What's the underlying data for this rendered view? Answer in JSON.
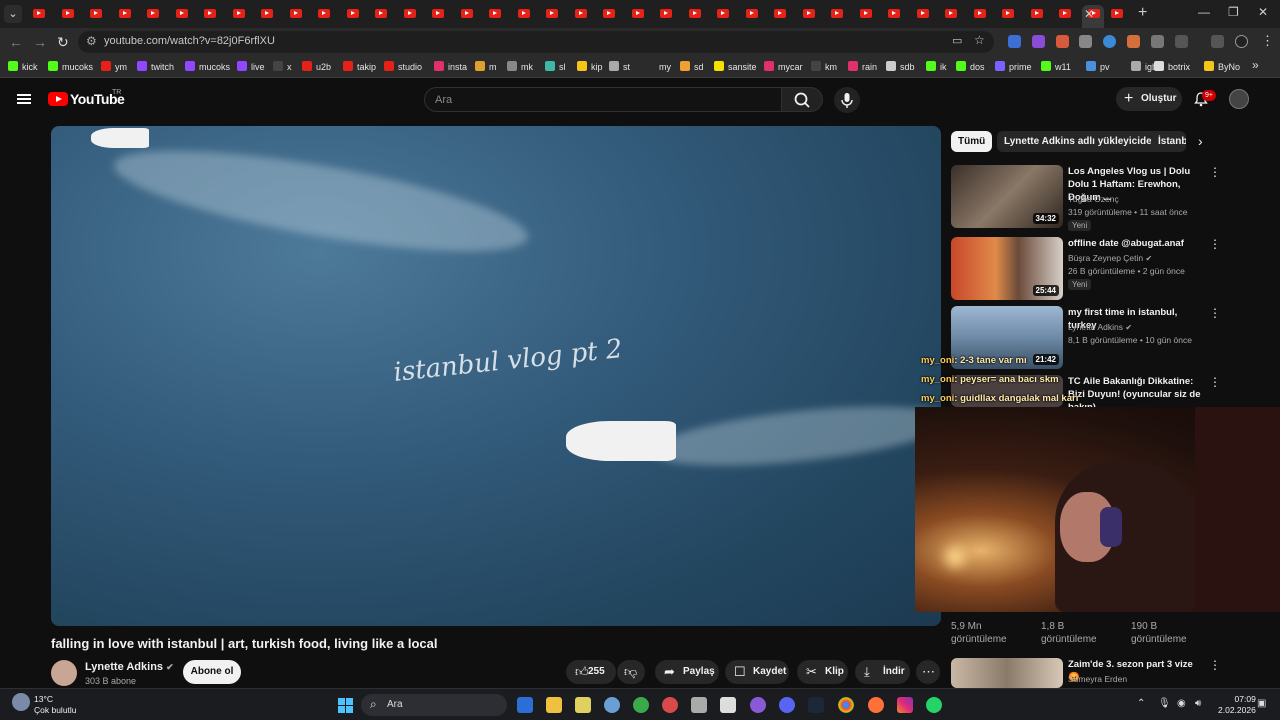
{
  "browser": {
    "url": "youtube.com/watch?v=82j0F6rflXU",
    "bookmarks": [
      {
        "label": "kick",
        "color": "#53fc18"
      },
      {
        "label": "mucoks",
        "color": "#53fc18"
      },
      {
        "label": "ym",
        "color": "#e62117"
      },
      {
        "label": "twitch",
        "color": "#9146ff"
      },
      {
        "label": "mucoks",
        "color": "#9146ff"
      },
      {
        "label": "live",
        "color": "#9146ff"
      },
      {
        "label": "x",
        "color": "#444444"
      },
      {
        "label": "u2b",
        "color": "#e62117"
      },
      {
        "label": "takip",
        "color": "#e62117"
      },
      {
        "label": "studio",
        "color": "#e62117"
      },
      {
        "label": "insta",
        "color": "#e1306c"
      },
      {
        "label": "m",
        "color": "#e0a030"
      },
      {
        "label": "mk",
        "color": "#888888"
      },
      {
        "label": "sl",
        "color": "#3fb6a8"
      },
      {
        "label": "kip",
        "color": "#f5c518"
      },
      {
        "label": "st",
        "color": "#aaaaaa"
      },
      {
        "label": "my",
        "color": "#2b2b2b"
      },
      {
        "label": "sd",
        "color": "#f0a030"
      },
      {
        "label": "sansite",
        "color": "#f5e000"
      },
      {
        "label": "mycar",
        "color": "#e1306c"
      },
      {
        "label": "km",
        "color": "#444444"
      },
      {
        "label": "rain",
        "color": "#e1306c"
      },
      {
        "label": "sdb",
        "color": "#cccccc"
      },
      {
        "label": "ik",
        "color": "#53fc18"
      },
      {
        "label": "dos",
        "color": "#53fc18"
      },
      {
        "label": "prime",
        "color": "#7b61ff"
      },
      {
        "label": "w11",
        "color": "#53fc18"
      },
      {
        "label": "pv",
        "color": "#4a90e2"
      },
      {
        "label": "igb",
        "color": "#aaaaaa"
      },
      {
        "label": "botrix",
        "color": "#dddddd"
      },
      {
        "label": "ByNo",
        "color": "#f5c518"
      }
    ]
  },
  "youtube": {
    "logo_text": "YouTube",
    "country": "TR",
    "search_placeholder": "Ara",
    "create_label": "Oluştur",
    "notif_count": "9+",
    "video": {
      "watermark": "istanbul vlog pt 2",
      "title": "falling in love with istanbul | art, turkish food, living like a local",
      "channel": "Lynette Adkins",
      "subscribers": "303 B abone",
      "subscribe_label": "Abone ol",
      "likes": "255",
      "share_label": "Paylaş",
      "save_label": "Kaydet",
      "clip_label": "Klip",
      "download_label": "İndir"
    },
    "chips": [
      "Tümü",
      "Lynette Adkins adlı yükleyiciden",
      "İstanb"
    ],
    "recommendations": [
      {
        "title": "Los Angeles Vlog us | Dolu Dolu 1 Haftam: Erewhon, Doğum ...",
        "channel": "Tuğba Özenç",
        "meta": "319 görüntüleme • 11 saat önce",
        "badge": "Yeni",
        "duration": "34:32",
        "thumb": "#6a5a4e"
      },
      {
        "title": "offline date @abugat.anaf",
        "channel": "Büşra Zeynep Çetin",
        "meta": "26 B görüntüleme • 2 gün önce",
        "badge": "Yeni",
        "duration": "25:44",
        "thumb": "#b04a2c"
      },
      {
        "title": "my first time in istanbul, turkey",
        "channel": "Lynette Adkins",
        "meta": "8,1 B görüntüleme • 10 gün önce",
        "badge": "",
        "duration": "21:42",
        "thumb": "#7a93b0"
      },
      {
        "title": "TC Aile Bakanlığı Dikkatine: Bizi Duyun! (oyuncular siz de bakın)",
        "channel": "",
        "meta": "",
        "badge": "",
        "duration": "",
        "thumb": "#4a4040"
      }
    ],
    "stats": [
      {
        "value": "5,9 Mn",
        "label": "görüntüleme"
      },
      {
        "value": "1,8 B",
        "label": "görüntüleme"
      },
      {
        "value": "190 B",
        "label": "görüntüleme"
      }
    ],
    "last_rec": {
      "title": "Zaim'de 3. sezon part 3 vize😡",
      "channel": "Sümeyra Erden"
    }
  },
  "chat": [
    {
      "user": "my_oni",
      "text": ": 2-3 tane var mı"
    },
    {
      "user": "my_oni",
      "text": ": peyser= ana bacı skm"
    },
    {
      "user": "my_oni",
      "text": ": guidllax dangalak mal karı"
    }
  ],
  "taskbar": {
    "temp": "13°C",
    "weather": "Çok bulutlu",
    "search": "Ara",
    "time": "07:09",
    "date": "2.02.2026"
  }
}
